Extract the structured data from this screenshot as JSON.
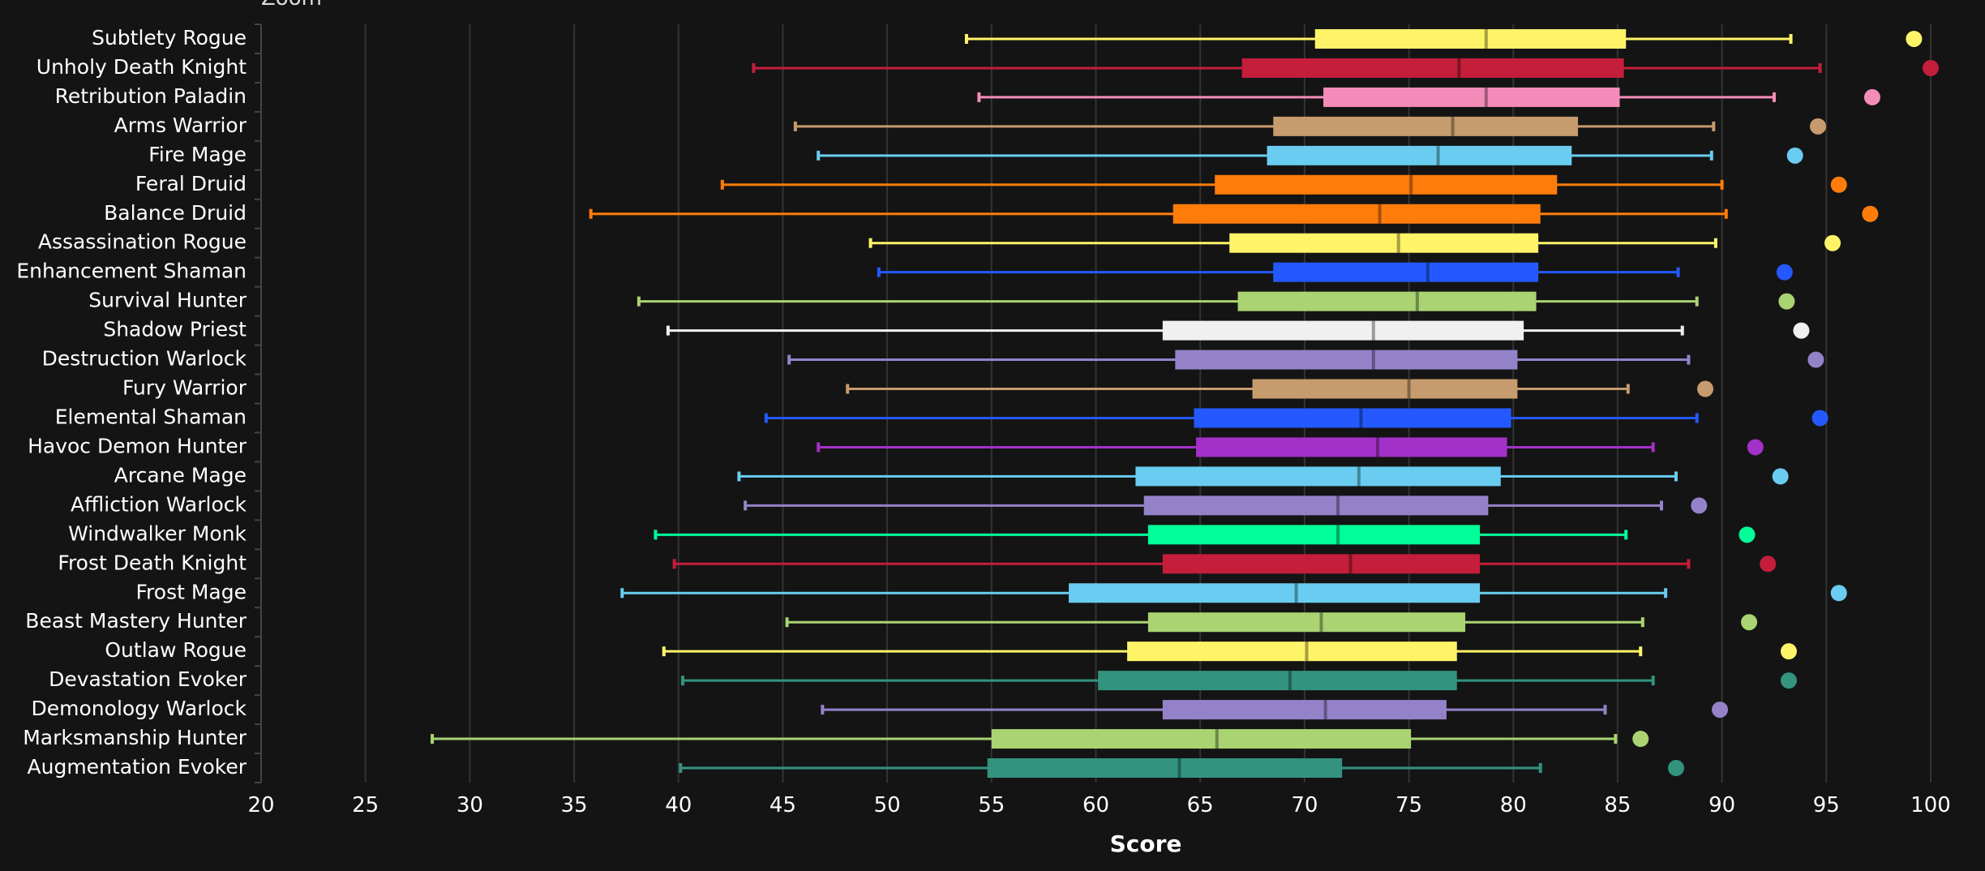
{
  "header": {
    "partial_title": "Zoom"
  },
  "chart_data": {
    "type": "boxplot",
    "title": "",
    "xlabel": "Score",
    "ylabel": "",
    "xlim": [
      20,
      100
    ],
    "xticks": [
      20,
      25,
      30,
      35,
      40,
      45,
      50,
      55,
      60,
      65,
      70,
      75,
      80,
      85,
      90,
      95,
      100
    ],
    "grid": "vertical",
    "orientation": "horizontal",
    "series": [
      {
        "name": "Subtlety Rogue",
        "color": "#FFF468",
        "min": 53.8,
        "q1": 70.5,
        "median": 78.7,
        "q3": 85.4,
        "max": 93.3,
        "top": 99.2
      },
      {
        "name": "Unholy Death Knight",
        "color": "#C41E3A",
        "min": 43.6,
        "q1": 67.0,
        "median": 77.4,
        "q3": 85.3,
        "max": 94.7,
        "top": 100.0
      },
      {
        "name": "Retribution Paladin",
        "color": "#F48CBA",
        "min": 54.4,
        "q1": 70.9,
        "median": 78.7,
        "q3": 85.1,
        "max": 92.5,
        "top": 97.2
      },
      {
        "name": "Arms Warrior",
        "color": "#C69B6D",
        "min": 45.6,
        "q1": 68.5,
        "median": 77.1,
        "q3": 83.1,
        "max": 89.6,
        "top": 94.6
      },
      {
        "name": "Fire Mage",
        "color": "#69CCF0",
        "min": 46.7,
        "q1": 68.2,
        "median": 76.4,
        "q3": 82.8,
        "max": 89.5,
        "top": 93.5
      },
      {
        "name": "Feral Druid",
        "color": "#FF7C0A",
        "min": 42.1,
        "q1": 65.7,
        "median": 75.1,
        "q3": 82.1,
        "max": 90.0,
        "top": 95.6
      },
      {
        "name": "Balance Druid",
        "color": "#FF7C0A",
        "min": 35.8,
        "q1": 63.7,
        "median": 73.6,
        "q3": 81.3,
        "max": 90.2,
        "top": 97.1
      },
      {
        "name": "Assassination Rogue",
        "color": "#FFF468",
        "min": 49.2,
        "q1": 66.4,
        "median": 74.5,
        "q3": 81.2,
        "max": 89.7,
        "top": 95.3
      },
      {
        "name": "Enhancement Shaman",
        "color": "#2359FF",
        "min": 49.6,
        "q1": 68.5,
        "median": 75.9,
        "q3": 81.2,
        "max": 87.9,
        "top": 93.0
      },
      {
        "name": "Survival Hunter",
        "color": "#AAD372",
        "min": 38.1,
        "q1": 66.8,
        "median": 75.4,
        "q3": 81.1,
        "max": 88.8,
        "top": 93.1
      },
      {
        "name": "Shadow Priest",
        "color": "#F0F0F0",
        "min": 39.5,
        "q1": 63.2,
        "median": 73.3,
        "q3": 80.5,
        "max": 88.1,
        "top": 93.8
      },
      {
        "name": "Destruction Warlock",
        "color": "#9482C9",
        "min": 45.3,
        "q1": 63.8,
        "median": 73.3,
        "q3": 80.2,
        "max": 88.4,
        "top": 94.5
      },
      {
        "name": "Fury Warrior",
        "color": "#C69B6D",
        "min": 48.1,
        "q1": 67.5,
        "median": 75.0,
        "q3": 80.2,
        "max": 85.5,
        "top": 89.2
      },
      {
        "name": "Elemental Shaman",
        "color": "#2359FF",
        "min": 44.2,
        "q1": 64.7,
        "median": 72.7,
        "q3": 79.9,
        "max": 88.8,
        "top": 94.7
      },
      {
        "name": "Havoc Demon Hunter",
        "color": "#A330C9",
        "min": 46.7,
        "q1": 64.8,
        "median": 73.5,
        "q3": 79.7,
        "max": 86.7,
        "top": 91.6
      },
      {
        "name": "Arcane Mage",
        "color": "#69CCF0",
        "min": 42.9,
        "q1": 61.9,
        "median": 72.6,
        "q3": 79.4,
        "max": 87.8,
        "top": 92.8
      },
      {
        "name": "Affliction Warlock",
        "color": "#9482C9",
        "min": 43.2,
        "q1": 62.3,
        "median": 71.6,
        "q3": 78.8,
        "max": 87.1,
        "top": 88.9
      },
      {
        "name": "Windwalker Monk",
        "color": "#00FF98",
        "min": 38.9,
        "q1": 62.5,
        "median": 71.6,
        "q3": 78.4,
        "max": 85.4,
        "top": 91.2
      },
      {
        "name": "Frost Death Knight",
        "color": "#C41E3A",
        "min": 39.8,
        "q1": 63.2,
        "median": 72.2,
        "q3": 78.4,
        "max": 88.4,
        "top": 92.2
      },
      {
        "name": "Frost Mage",
        "color": "#69CCF0",
        "min": 37.3,
        "q1": 58.7,
        "median": 69.6,
        "q3": 78.4,
        "max": 87.3,
        "top": 95.6
      },
      {
        "name": "Beast Mastery Hunter",
        "color": "#AAD372",
        "min": 45.2,
        "q1": 62.5,
        "median": 70.8,
        "q3": 77.7,
        "max": 86.2,
        "top": 91.3
      },
      {
        "name": "Outlaw Rogue",
        "color": "#FFF468",
        "min": 39.3,
        "q1": 61.5,
        "median": 70.1,
        "q3": 77.3,
        "max": 86.1,
        "top": 93.2
      },
      {
        "name": "Devastation Evoker",
        "color": "#33937F",
        "min": 40.2,
        "q1": 60.1,
        "median": 69.3,
        "q3": 77.3,
        "max": 86.7,
        "top": 93.2
      },
      {
        "name": "Demonology Warlock",
        "color": "#9482C9",
        "min": 46.9,
        "q1": 63.2,
        "median": 71.0,
        "q3": 76.8,
        "max": 84.4,
        "top": 89.9
      },
      {
        "name": "Marksmanship Hunter",
        "color": "#AAD372",
        "min": 28.2,
        "q1": 55.0,
        "median": 65.8,
        "q3": 75.1,
        "max": 84.9,
        "top": 86.1
      },
      {
        "name": "Augmentation Evoker",
        "color": "#33937F",
        "min": 40.1,
        "q1": 54.8,
        "median": 64.0,
        "q3": 71.8,
        "max": 81.3,
        "top": 87.8
      }
    ]
  }
}
